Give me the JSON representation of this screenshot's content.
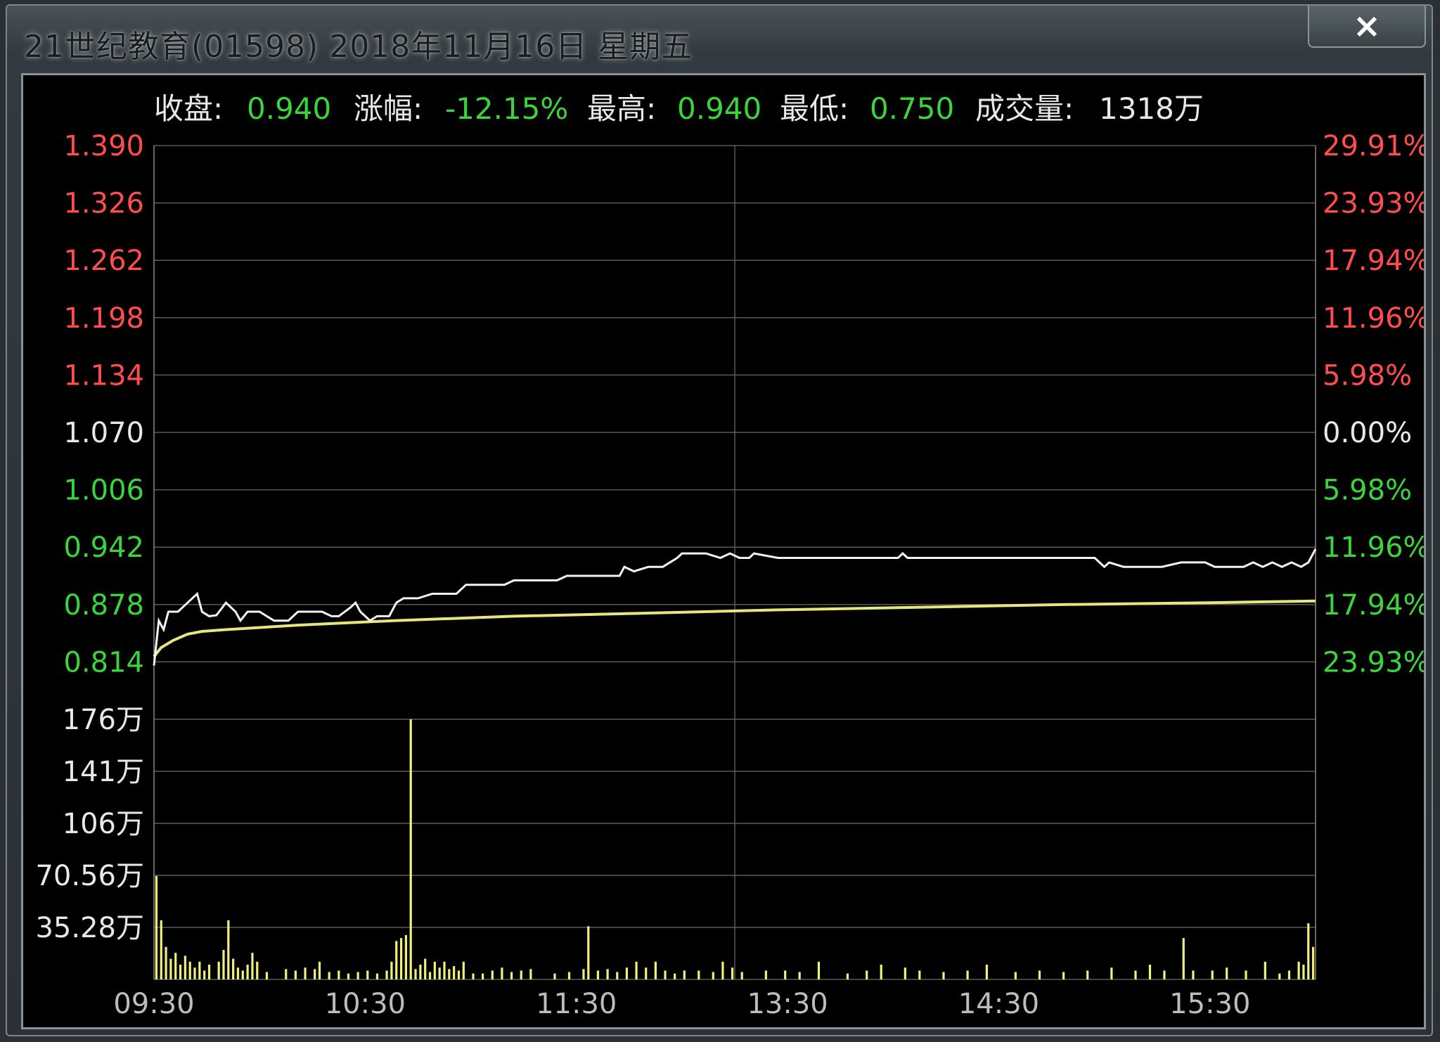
{
  "window": {
    "title": "21世纪教育(01598)  2018年11月16日  星期五",
    "close_label": "×"
  },
  "summary": {
    "close_label": "收盘:",
    "close_value": "0.940",
    "change_label": "涨幅:",
    "change_value": "-12.15%",
    "high_label": "最高:",
    "high_value": "0.940",
    "low_label": "最低:",
    "low_value": "0.750",
    "volume_label": "成交量:",
    "volume_value": "1318万"
  },
  "colors": {
    "up": "#ff4d4d",
    "down": "#3bd43b",
    "neutral": "#e8e8e8",
    "price_line": "#f2f2f2",
    "avg_line": "#e6e680",
    "volume_bar": "#f0f07a",
    "grid": "#5a5a5a"
  },
  "chart_data": {
    "type": "line",
    "prev_close": 1.07,
    "price_axis": {
      "ticks": [
        "1.390",
        "1.326",
        "1.262",
        "1.198",
        "1.134",
        "1.070",
        "1.006",
        "0.942",
        "0.878",
        "0.814"
      ],
      "pct_ticks": [
        "29.91%",
        "23.93%",
        "17.94%",
        "11.96%",
        "5.98%",
        "0.00%",
        "5.98%",
        "11.96%",
        "17.94%",
        "23.93%"
      ],
      "range": [
        0.814,
        1.39
      ]
    },
    "volume_axis": {
      "ticks": [
        "176万",
        "141万",
        "106万",
        "70.56万",
        "35.28万"
      ],
      "range": [
        0,
        176
      ]
    },
    "x_ticks": [
      "09:30",
      "10:30",
      "11:30",
      "13:30",
      "14:30",
      "15:30"
    ],
    "price_series": {
      "name": "price",
      "points": [
        [
          0,
          0.81
        ],
        [
          2,
          0.86
        ],
        [
          4,
          0.85
        ],
        [
          6,
          0.87
        ],
        [
          10,
          0.87
        ],
        [
          14,
          0.88
        ],
        [
          18,
          0.89
        ],
        [
          20,
          0.87
        ],
        [
          23,
          0.865
        ],
        [
          26,
          0.866
        ],
        [
          30,
          0.88
        ],
        [
          34,
          0.87
        ],
        [
          36,
          0.86
        ],
        [
          39,
          0.87
        ],
        [
          44,
          0.87
        ],
        [
          47,
          0.865
        ],
        [
          50,
          0.86
        ],
        [
          56,
          0.86
        ],
        [
          60,
          0.87
        ],
        [
          66,
          0.87
        ],
        [
          70,
          0.87
        ],
        [
          74,
          0.865
        ],
        [
          77,
          0.865
        ],
        [
          82,
          0.875
        ],
        [
          84,
          0.88
        ],
        [
          86,
          0.87
        ],
        [
          90,
          0.86
        ],
        [
          93,
          0.865
        ],
        [
          98,
          0.865
        ],
        [
          101,
          0.88
        ],
        [
          104,
          0.885
        ],
        [
          110,
          0.885
        ],
        [
          116,
          0.89
        ],
        [
          126,
          0.89
        ],
        [
          130,
          0.9
        ],
        [
          146,
          0.9
        ],
        [
          150,
          0.905
        ],
        [
          168,
          0.905
        ],
        [
          172,
          0.91
        ],
        [
          194,
          0.91
        ],
        [
          196,
          0.92
        ],
        [
          200,
          0.915
        ],
        [
          206,
          0.92
        ],
        [
          212,
          0.92
        ],
        [
          218,
          0.93
        ],
        [
          220,
          0.935
        ],
        [
          230,
          0.935
        ],
        [
          236,
          0.93
        ],
        [
          240,
          0.935
        ],
        [
          244,
          0.93
        ],
        [
          248,
          0.93
        ],
        [
          250,
          0.935
        ],
        [
          260,
          0.93
        ],
        [
          276,
          0.93
        ],
        [
          310,
          0.93
        ],
        [
          312,
          0.935
        ],
        [
          314,
          0.93
        ],
        [
          360,
          0.93
        ],
        [
          392,
          0.93
        ],
        [
          394,
          0.925
        ],
        [
          396,
          0.92
        ],
        [
          398,
          0.925
        ],
        [
          404,
          0.92
        ],
        [
          420,
          0.92
        ],
        [
          428,
          0.925
        ],
        [
          438,
          0.925
        ],
        [
          442,
          0.92
        ],
        [
          454,
          0.92
        ],
        [
          458,
          0.925
        ],
        [
          462,
          0.92
        ],
        [
          466,
          0.925
        ],
        [
          470,
          0.92
        ],
        [
          474,
          0.925
        ],
        [
          478,
          0.92
        ],
        [
          481,
          0.925
        ],
        [
          484,
          0.94
        ]
      ]
    },
    "avg_series": {
      "name": "average",
      "points": [
        [
          0,
          0.82
        ],
        [
          3,
          0.83
        ],
        [
          8,
          0.838
        ],
        [
          14,
          0.845
        ],
        [
          20,
          0.848
        ],
        [
          30,
          0.85
        ],
        [
          60,
          0.855
        ],
        [
          100,
          0.86
        ],
        [
          150,
          0.865
        ],
        [
          200,
          0.868
        ],
        [
          260,
          0.872
        ],
        [
          320,
          0.875
        ],
        [
          380,
          0.878
        ],
        [
          440,
          0.88
        ],
        [
          484,
          0.882
        ]
      ]
    },
    "volume_series": {
      "name": "volume",
      "points": [
        [
          1,
          70
        ],
        [
          3,
          40
        ],
        [
          5,
          22
        ],
        [
          7,
          14
        ],
        [
          9,
          18
        ],
        [
          11,
          10
        ],
        [
          13,
          16
        ],
        [
          15,
          12
        ],
        [
          17,
          8
        ],
        [
          19,
          12
        ],
        [
          21,
          6
        ],
        [
          23,
          10
        ],
        [
          27,
          12
        ],
        [
          29,
          20
        ],
        [
          31,
          40
        ],
        [
          33,
          14
        ],
        [
          35,
          8
        ],
        [
          37,
          6
        ],
        [
          39,
          10
        ],
        [
          41,
          18
        ],
        [
          43,
          12
        ],
        [
          47,
          5
        ],
        [
          55,
          7
        ],
        [
          59,
          6
        ],
        [
          63,
          8
        ],
        [
          67,
          7
        ],
        [
          69,
          12
        ],
        [
          73,
          5
        ],
        [
          77,
          6
        ],
        [
          81,
          4
        ],
        [
          85,
          5
        ],
        [
          89,
          6
        ],
        [
          93,
          4
        ],
        [
          97,
          6
        ],
        [
          99,
          12
        ],
        [
          101,
          26
        ],
        [
          103,
          28
        ],
        [
          105,
          30
        ],
        [
          107,
          176
        ],
        [
          109,
          7
        ],
        [
          111,
          10
        ],
        [
          113,
          14
        ],
        [
          115,
          5
        ],
        [
          117,
          12
        ],
        [
          119,
          8
        ],
        [
          121,
          12
        ],
        [
          123,
          7
        ],
        [
          125,
          9
        ],
        [
          127,
          6
        ],
        [
          129,
          12
        ],
        [
          133,
          4
        ],
        [
          137,
          4
        ],
        [
          141,
          6
        ],
        [
          145,
          8
        ],
        [
          149,
          5
        ],
        [
          153,
          6
        ],
        [
          157,
          7
        ],
        [
          167,
          4
        ],
        [
          173,
          5
        ],
        [
          179,
          7
        ],
        [
          181,
          36
        ],
        [
          185,
          6
        ],
        [
          189,
          7
        ],
        [
          193,
          5
        ],
        [
          197,
          8
        ],
        [
          201,
          12
        ],
        [
          205,
          8
        ],
        [
          209,
          12
        ],
        [
          213,
          6
        ],
        [
          217,
          4
        ],
        [
          221,
          6
        ],
        [
          227,
          6
        ],
        [
          233,
          5
        ],
        [
          237,
          12
        ],
        [
          241,
          8
        ],
        [
          245,
          5
        ],
        [
          255,
          6
        ],
        [
          263,
          6
        ],
        [
          269,
          5
        ],
        [
          277,
          12
        ],
        [
          289,
          4
        ],
        [
          297,
          6
        ],
        [
          303,
          10
        ],
        [
          313,
          8
        ],
        [
          319,
          6
        ],
        [
          329,
          5
        ],
        [
          339,
          6
        ],
        [
          347,
          10
        ],
        [
          359,
          5
        ],
        [
          369,
          6
        ],
        [
          379,
          5
        ],
        [
          389,
          6
        ],
        [
          399,
          8
        ],
        [
          409,
          6
        ],
        [
          415,
          10
        ],
        [
          421,
          6
        ],
        [
          429,
          28
        ],
        [
          433,
          6
        ],
        [
          441,
          6
        ],
        [
          447,
          8
        ],
        [
          455,
          6
        ],
        [
          463,
          12
        ],
        [
          469,
          4
        ],
        [
          473,
          6
        ],
        [
          477,
          12
        ],
        [
          479,
          10
        ],
        [
          481,
          38
        ],
        [
          483,
          22
        ]
      ]
    },
    "minutes_total": 484
  }
}
